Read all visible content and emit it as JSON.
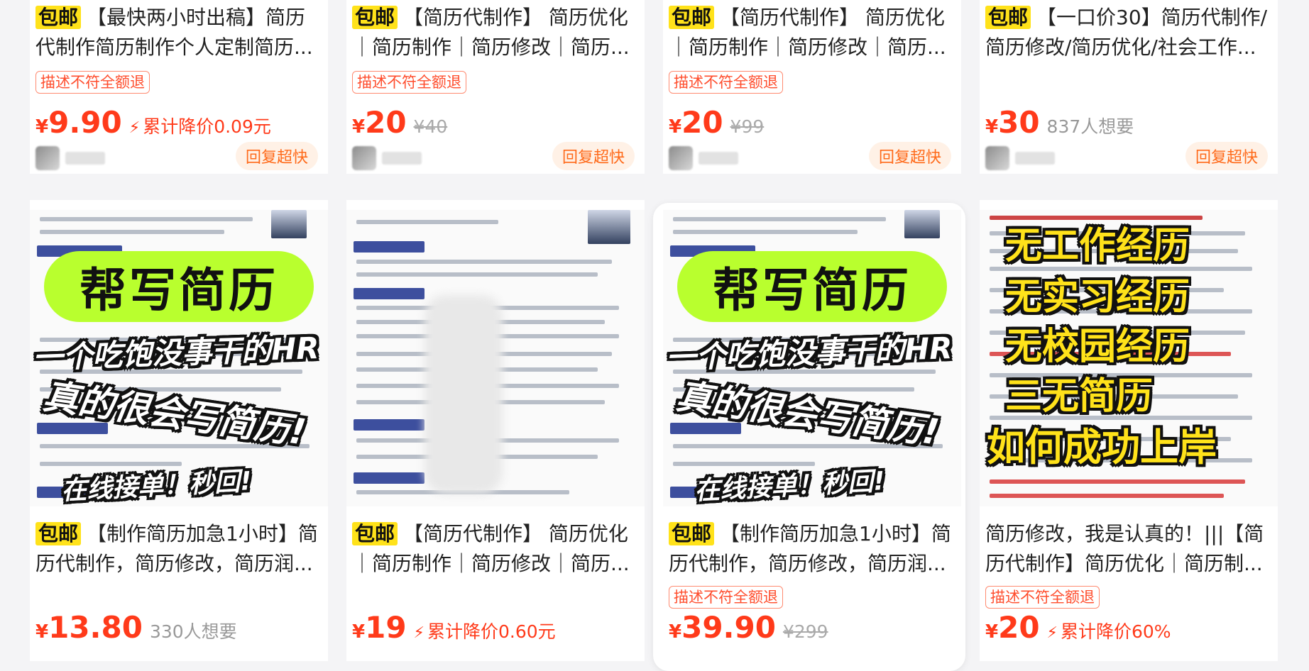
{
  "colors": {
    "accent": "#ff3a1a",
    "baoyou": "#ffe21a",
    "banner": "#b9ff2e"
  },
  "cards": [
    {
      "title_prefix": "包邮",
      "title": "【最快两小时出稿】简历代制作简历制作个人定制简历...",
      "tag": "描述不符全额退",
      "currency": "¥",
      "price": "9.90",
      "orig": "",
      "want": "",
      "drop": "累计降价0.09元",
      "reply": "回复超快"
    },
    {
      "title_prefix": "包邮",
      "title": "【简历代制作】 简历优化｜简历制作｜简历修改｜简历...",
      "tag": "描述不符全额退",
      "currency": "¥",
      "price": "20",
      "orig": "¥40",
      "want": "",
      "drop": "",
      "reply": "回复超快"
    },
    {
      "title_prefix": "包邮",
      "title": "【简历代制作】 简历优化｜简历制作｜简历修改｜简历...",
      "tag": "描述不符全额退",
      "currency": "¥",
      "price": "20",
      "orig": "¥99",
      "want": "",
      "drop": "",
      "reply": "回复超快"
    },
    {
      "title_prefix": "包邮",
      "title": "【一口价30】简历代制作/简历修改/简历优化/社会工作...",
      "tag": "",
      "currency": "¥",
      "price": "30",
      "orig": "",
      "want": "837人想要",
      "drop": "",
      "reply": "回复超快"
    },
    {
      "title_prefix": "包邮",
      "title": "【制作简历加急1小时】简历代制作，简历修改，简历润...",
      "tag": "",
      "currency": "¥",
      "price": "13.80",
      "orig": "",
      "want": "330人想要",
      "drop": "",
      "thumb": {
        "banner": "帮写简历",
        "line1": "一个吃饱没事干的HR",
        "line2": "真的很会写简历!",
        "line3": "在线接单！秒回!"
      }
    },
    {
      "title_prefix": "包邮",
      "title": "【简历代制作】 简历优化｜简历制作｜简历修改｜简历...",
      "tag": "",
      "currency": "¥",
      "price": "19",
      "orig": "",
      "want": "",
      "drop": "累计降价0.60元"
    },
    {
      "title_prefix": "包邮",
      "title": "【制作简历加急1小时】简历代制作，简历修改，简历润...",
      "tag": "描述不符全额退",
      "currency": "¥",
      "price": "39.90",
      "orig": "¥299",
      "want": "",
      "drop": "",
      "thumb": {
        "banner": "帮写简历",
        "line1": "一个吃饱没事干的HR",
        "line2": "真的很会写简历!",
        "line3": "在线接单！秒回!"
      }
    },
    {
      "title_prefix": "",
      "title": "简历修改，我是认真的！|||【简历代制作】简历优化｜简历制...",
      "tag": "描述不符全额退",
      "currency": "¥",
      "price": "20",
      "orig": "",
      "want": "",
      "drop": "累计降价60%",
      "thumb": {
        "l1": "无工作经历",
        "l2": "无实习经历",
        "l3": "无校园经历",
        "l4": "三无简历",
        "l5": "如何成功上岸"
      }
    }
  ]
}
